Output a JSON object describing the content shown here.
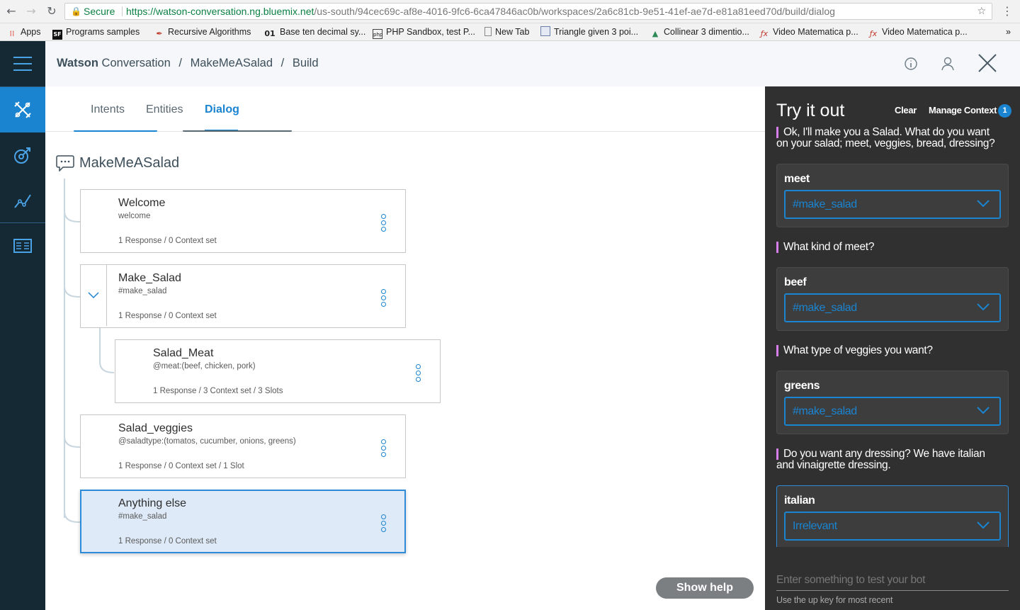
{
  "browser": {
    "secure_label": "Secure",
    "url_host": "https://watson-conversation.ng.bluemix.net",
    "url_path": "/us-south/94cec69c-af8e-4016-9fc6-6ca47846ac0b/workspaces/2a6c81cb-9e51-41ef-ae7d-e81a81eed70d/build/dialog",
    "bookmarks": [
      {
        "label": "Apps",
        "icon": "apps-grid-icon"
      },
      {
        "label": "Programs samples",
        "icon": "sf-icon"
      },
      {
        "label": "Recursive Algorithms",
        "icon": "feather-icon"
      },
      {
        "label": "Base ten decimal sy...",
        "icon": "01-icon"
      },
      {
        "label": "PHP Sandbox, test P...",
        "icon": "php-icon"
      },
      {
        "label": "New Tab",
        "icon": "page-icon"
      },
      {
        "label": "Triangle given 3 poi...",
        "icon": "image-icon"
      },
      {
        "label": "Collinear 3 dimentio...",
        "icon": "triangle-icon"
      },
      {
        "label": "Video Matematica p...",
        "icon": "fx-icon"
      },
      {
        "label": "Video Matematica p...",
        "icon": "fx-icon"
      }
    ],
    "bookmarks_overflow": "»"
  },
  "header": {
    "brand_bold": "Watson",
    "brand_rest": " Conversation",
    "crumb_workspace": "MakeMeASalad",
    "crumb_page": "Build",
    "separator": "/"
  },
  "tabs": [
    {
      "label": "Intents"
    },
    {
      "label": "Entities"
    },
    {
      "label": "Dialog"
    }
  ],
  "dialog": {
    "workspace_name": "MakeMeASalad",
    "nodes": [
      {
        "name": "Welcome",
        "condition": "welcome",
        "meta": "1 Response / 0 Context set"
      },
      {
        "name": "Make_Salad",
        "condition": "#make_salad",
        "meta": "1 Response / 0 Context set"
      },
      {
        "name": "Salad_Meat",
        "condition": "@meat:(beef, chicken, pork)",
        "meta": "1 Response / 3 Context set / 3 Slots"
      },
      {
        "name": "Salad_veggies",
        "condition": "@saladtype:(tomatos, cucumber, onions, greens)",
        "meta": "1 Response / 0 Context set / 1 Slot"
      },
      {
        "name": "Anything else",
        "condition": "#make_salad",
        "meta": "1 Response / 0 Context set"
      }
    ],
    "show_help_label": "Show help"
  },
  "tryit": {
    "title": "Try it out",
    "clear_label": "Clear",
    "manage_context_label": "Manage Context",
    "context_count": "1",
    "messages": [
      {
        "bot_line1": "Ok, I'll make you a Salad. What do you want",
        "bot_line2": "on your salad; meet, veggies, bread, dressing?",
        "user": "meet",
        "intent": "#make_salad"
      },
      {
        "bot_line1": "What kind of meet?",
        "bot_line2": "",
        "user": "beef",
        "intent": "#make_salad"
      },
      {
        "bot_line1": "What type of veggies you want?",
        "bot_line2": "",
        "user": "greens",
        "intent": "#make_salad"
      },
      {
        "bot_line1": "Do you want any dressing? We have italian",
        "bot_line2": "and vinaigrette dressing.",
        "user": "italian",
        "intent": "Irrelevant"
      }
    ],
    "input_placeholder": "Enter something to test your bot",
    "hint": "Use the up key for most recent"
  },
  "colors": {
    "accent": "#1a84d0",
    "rail_bg": "#152935",
    "panel_bg": "#303030",
    "bot_marker": "#d67ee9"
  }
}
